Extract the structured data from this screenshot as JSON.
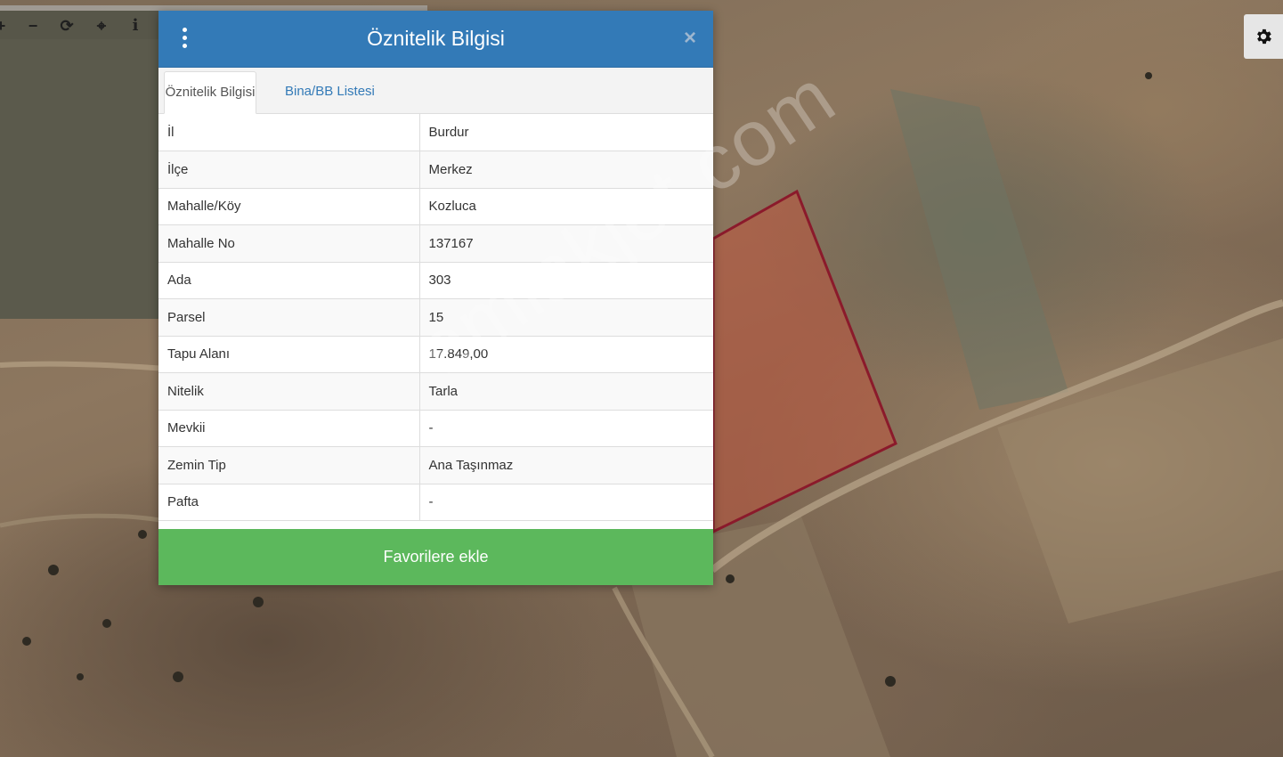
{
  "toolbar": {
    "tools": [
      {
        "icon": "zoom-in-icon"
      },
      {
        "icon": "zoom-out-icon"
      },
      {
        "icon": "refresh-icon"
      },
      {
        "icon": "locate-icon"
      },
      {
        "icon": "info-icon"
      }
    ]
  },
  "settings": {
    "icon": "gear-icon"
  },
  "watermark": "emlakjet.com",
  "modal": {
    "title": "Öznitelik Bilgisi",
    "menu_icon": "vertical-dots-icon",
    "close_label": "×",
    "tabs": [
      {
        "label": "Öznitelik Bilgisi",
        "active": true
      },
      {
        "label": "Bina/BB Listesi",
        "active": false
      }
    ],
    "rows": [
      {
        "key": "İl",
        "value": "Burdur"
      },
      {
        "key": "İlçe",
        "value": "Merkez"
      },
      {
        "key": "Mahalle/Köy",
        "value": "Kozluca"
      },
      {
        "key": "Mahalle No",
        "value": "137167"
      },
      {
        "key": "Ada",
        "value": "303"
      },
      {
        "key": "Parsel",
        "value": "15"
      },
      {
        "key": "Tapu Alanı",
        "value": "17.849,00"
      },
      {
        "key": "Nitelik",
        "value": "Tarla"
      },
      {
        "key": "Mevkii",
        "value": "-"
      },
      {
        "key": "Zemin Tip",
        "value": "Ana Taşınmaz"
      },
      {
        "key": "Pafta",
        "value": "-"
      }
    ],
    "favorite_button": "Favorilere ekle"
  },
  "colors": {
    "header": "#337ab7",
    "favorite_button": "#5cb85c",
    "parcel_outline": "#8b1a2b",
    "parcel_fill": "#c0553e"
  }
}
